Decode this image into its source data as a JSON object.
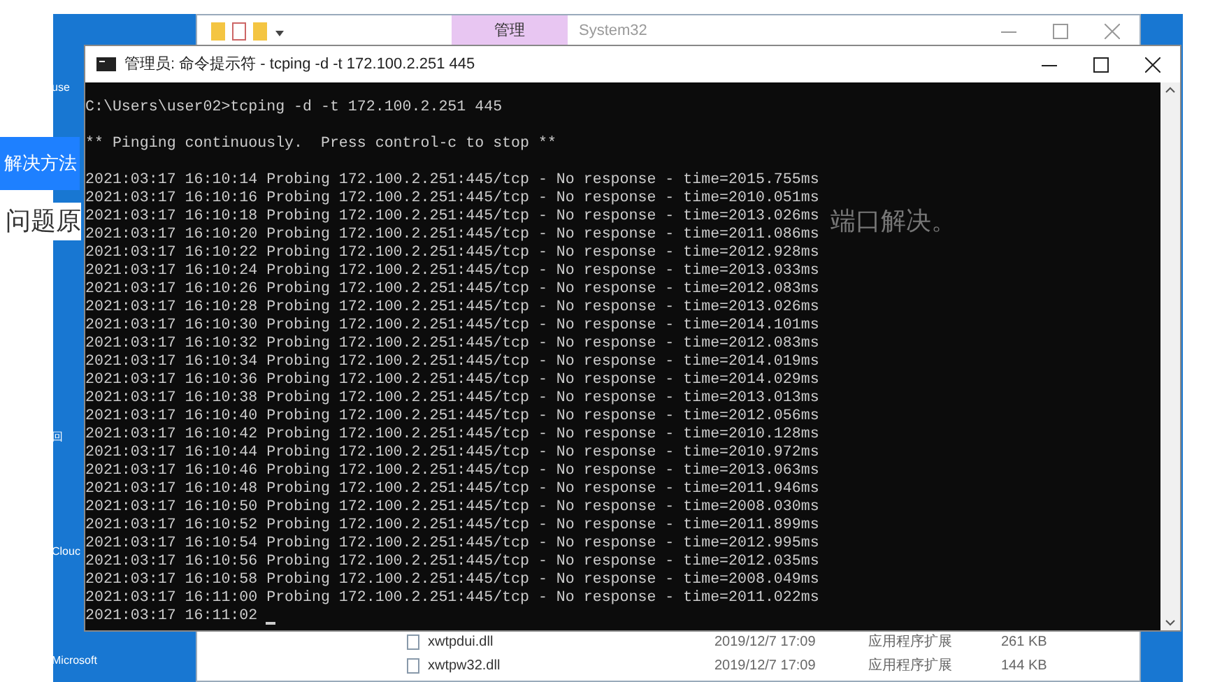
{
  "desktop_icons": [
    {
      "label": "use"
    },
    {
      "label": "回"
    },
    {
      "label": "Clouc"
    },
    {
      "label": "Microsoft"
    }
  ],
  "explorer": {
    "ribbon_tab": "管理",
    "title": "System32",
    "files": [
      {
        "name": "xwtpdui.dll",
        "date": "2019/12/7 17:09",
        "type": "应用程序扩展",
        "size": "261 KB"
      },
      {
        "name": "xwtpw32.dll",
        "date": "2019/12/7 17:09",
        "type": "应用程序扩展",
        "size": "144 KB"
      }
    ]
  },
  "console": {
    "title": "管理员: 命令提示符 - tcping  -d -t 172.100.2.251 445",
    "command": "C:\\Users\\user02>tcping -d -t 172.100.2.251 445",
    "banner": "** Pinging continuously.  Press control-c to stop **",
    "lines": [
      "2021:03:17 16:10:14 Probing 172.100.2.251:445/tcp - No response - time=2015.755ms",
      "2021:03:17 16:10:16 Probing 172.100.2.251:445/tcp - No response - time=2010.051ms",
      "2021:03:17 16:10:18 Probing 172.100.2.251:445/tcp - No response - time=2013.026ms",
      "2021:03:17 16:10:20 Probing 172.100.2.251:445/tcp - No response - time=2011.086ms",
      "2021:03:17 16:10:22 Probing 172.100.2.251:445/tcp - No response - time=2012.928ms",
      "2021:03:17 16:10:24 Probing 172.100.2.251:445/tcp - No response - time=2013.033ms",
      "2021:03:17 16:10:26 Probing 172.100.2.251:445/tcp - No response - time=2012.083ms",
      "2021:03:17 16:10:28 Probing 172.100.2.251:445/tcp - No response - time=2013.026ms",
      "2021:03:17 16:10:30 Probing 172.100.2.251:445/tcp - No response - time=2014.101ms",
      "2021:03:17 16:10:32 Probing 172.100.2.251:445/tcp - No response - time=2012.083ms",
      "2021:03:17 16:10:34 Probing 172.100.2.251:445/tcp - No response - time=2014.019ms",
      "2021:03:17 16:10:36 Probing 172.100.2.251:445/tcp - No response - time=2014.029ms",
      "2021:03:17 16:10:38 Probing 172.100.2.251:445/tcp - No response - time=2013.013ms",
      "2021:03:17 16:10:40 Probing 172.100.2.251:445/tcp - No response - time=2012.056ms",
      "2021:03:17 16:10:42 Probing 172.100.2.251:445/tcp - No response - time=2010.128ms",
      "2021:03:17 16:10:44 Probing 172.100.2.251:445/tcp - No response - time=2010.972ms",
      "2021:03:17 16:10:46 Probing 172.100.2.251:445/tcp - No response - time=2013.063ms",
      "2021:03:17 16:10:48 Probing 172.100.2.251:445/tcp - No response - time=2011.946ms",
      "2021:03:17 16:10:50 Probing 172.100.2.251:445/tcp - No response - time=2008.030ms",
      "2021:03:17 16:10:52 Probing 172.100.2.251:445/tcp - No response - time=2011.899ms",
      "2021:03:17 16:10:54 Probing 172.100.2.251:445/tcp - No response - time=2012.995ms",
      "2021:03:17 16:10:56 Probing 172.100.2.251:445/tcp - No response - time=2012.035ms",
      "2021:03:17 16:10:58 Probing 172.100.2.251:445/tcp - No response - time=2008.049ms",
      "2021:03:17 16:11:00 Probing 172.100.2.251:445/tcp - No response - time=2011.022ms",
      "2021:03:17 16:11:02"
    ]
  },
  "article": {
    "heading": "解决方法",
    "text_start": "问题原",
    "text_end": "端口解决。"
  }
}
